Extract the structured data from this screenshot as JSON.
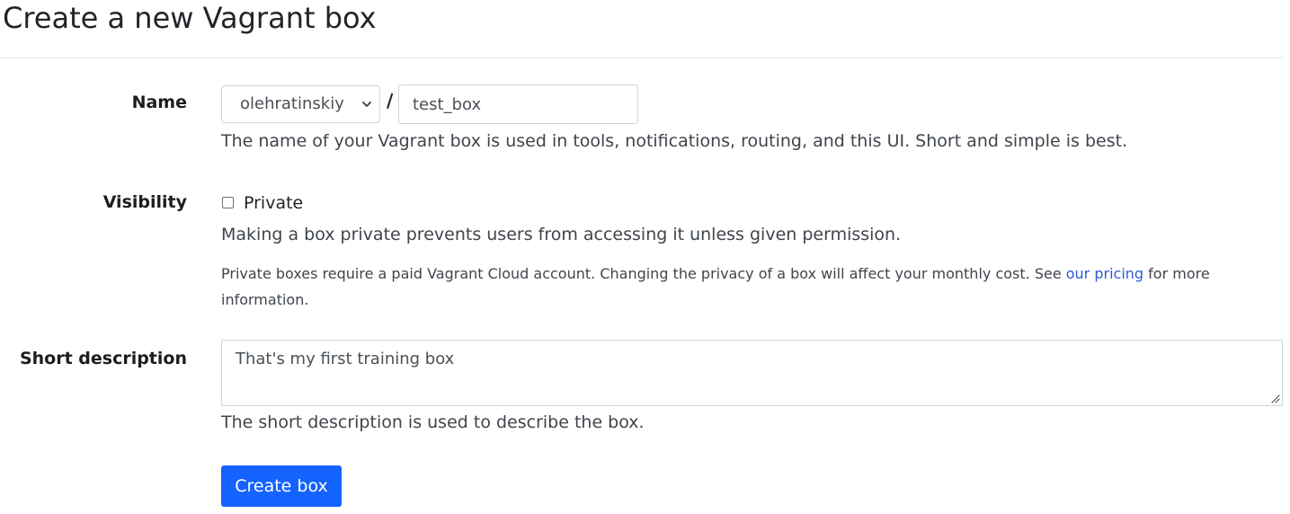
{
  "page": {
    "title": "Create a new Vagrant box"
  },
  "form": {
    "name": {
      "label": "Name",
      "owner_selected": "olehratinskiy",
      "separator": "/",
      "box_name_value": "test_box",
      "help": "The name of your Vagrant box is used in tools, notifications, routing, and this UI. Short and simple is best."
    },
    "visibility": {
      "label": "Visibility",
      "checkbox_label": "Private",
      "checked": false,
      "help": "Making a box private prevents users from accessing it unless given permission.",
      "pricing_note_before": "Private boxes require a paid Vagrant Cloud account. Changing the privacy of a box will affect your monthly cost. See ",
      "pricing_link": "our pricing",
      "pricing_note_after": " for more information."
    },
    "short_description": {
      "label": "Short description",
      "value": "That's my first training box",
      "help": "The short description is used to describe the box."
    },
    "submit_label": "Create box"
  },
  "colors": {
    "primary_button": "#1563ff",
    "link": "#2d5bd7",
    "border": "#ced4da"
  },
  "icons": {
    "select_arrow": "chevron-down-icon",
    "textarea_resize": "resize-handle-icon"
  }
}
